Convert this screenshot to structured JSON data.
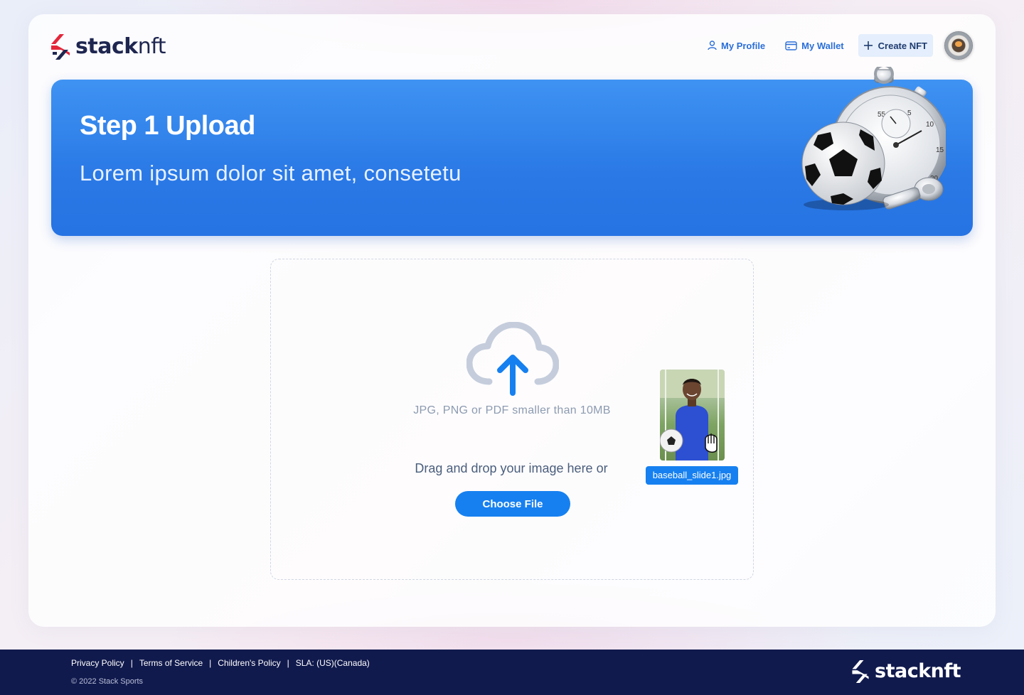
{
  "brand": {
    "name_bold": "stack",
    "name_light": "nft",
    "accent_color": "#e4263a",
    "navy_color": "#1e2650"
  },
  "header": {
    "nav": {
      "profile_label": "My Profile",
      "wallet_label": "My Wallet",
      "create_label": "Create NFT"
    },
    "avatar_icon": "user-avatar"
  },
  "banner": {
    "title": "Step 1 Upload",
    "subtitle": "Lorem ipsum dolor sit amet, consetetu",
    "art_icon": "stopwatch-soccer-whistle"
  },
  "upload": {
    "icon": "cloud-upload-icon",
    "formats_text": "JPG, PNG or PDF smaller than 10MB",
    "drag_text": "Drag and drop your image here or",
    "choose_label": "Choose File",
    "dragged_file": {
      "name": "baseball_slide1.jpg",
      "cursor_icon": "grab-hand-icon"
    },
    "primary_color": "#1680f0"
  },
  "footer": {
    "links": [
      "Privacy Policy",
      "Terms of Service",
      "Children's Policy",
      "SLA: (US)(Canada)"
    ],
    "separator": "|",
    "copyright": "© 2022 Stack Sports",
    "background": "#111a4d"
  }
}
